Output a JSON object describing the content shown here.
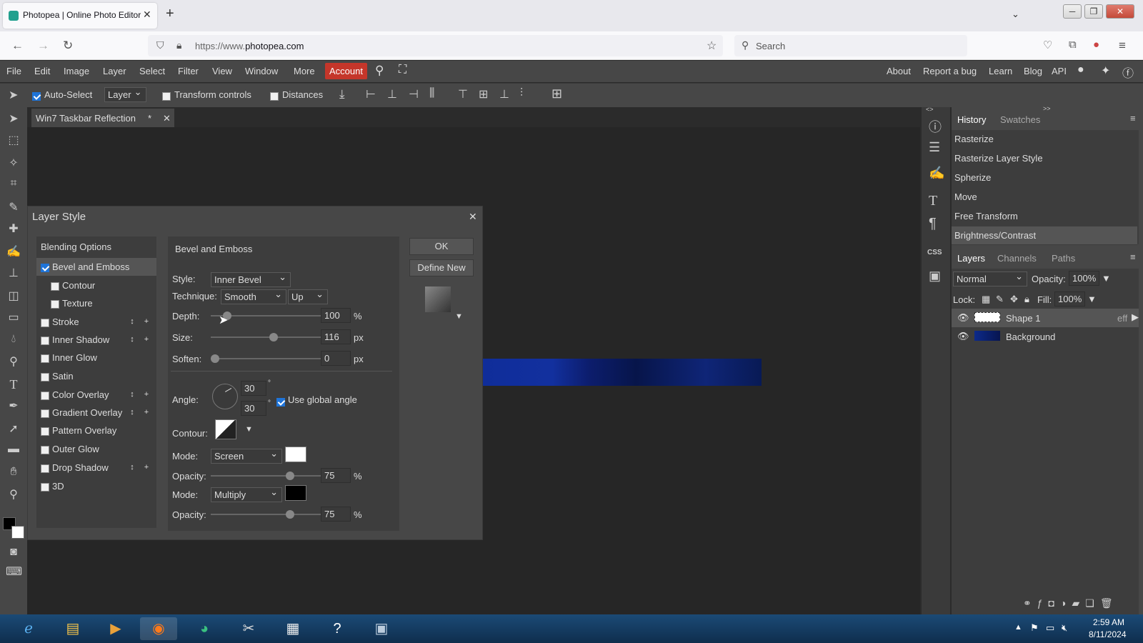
{
  "browser": {
    "tab_title": "Photopea | Online Photo Editor",
    "url_prefix": "https://www.",
    "url_domain": "photopea.com",
    "search_placeholder": "Search"
  },
  "menubar": {
    "items": [
      "File",
      "Edit",
      "Image",
      "Layer",
      "Select",
      "Filter",
      "View",
      "Window",
      "More"
    ],
    "account": "Account",
    "right_links": [
      "About",
      "Report a bug",
      "Learn",
      "Blog",
      "API"
    ]
  },
  "options": {
    "auto_select": "Auto-Select",
    "auto_select_checked": true,
    "target": "Layer",
    "transform_controls": "Transform controls",
    "distances": "Distances"
  },
  "document": {
    "tab": "Win7 Taskbar Reflection",
    "modified": "*"
  },
  "history": {
    "tabs": [
      "History",
      "Swatches"
    ],
    "items": [
      "Rasterize",
      "Rasterize Layer Style",
      "Spherize",
      "Move",
      "Free Transform",
      "Brightness/Contrast"
    ]
  },
  "layers": {
    "tabs": [
      "Layers",
      "Channels",
      "Paths"
    ],
    "blend_mode": "Normal",
    "opacity_label": "Opacity:",
    "opacity": "100%",
    "lock_label": "Lock:",
    "fill_label": "Fill:",
    "fill": "100%",
    "items": [
      {
        "name": "Shape 1",
        "fx": "eff"
      },
      {
        "name": "Background",
        "fx": ""
      }
    ]
  },
  "dialog": {
    "title": "Layer Style",
    "ok": "OK",
    "define_new": "Define New",
    "list": [
      {
        "label": "Blending Options"
      },
      {
        "label": "Bevel and Emboss",
        "checked": true
      },
      {
        "label": "Contour",
        "checked": false
      },
      {
        "label": "Texture",
        "checked": false
      },
      {
        "label": "Stroke",
        "checked": false
      },
      {
        "label": "Inner Shadow",
        "checked": false
      },
      {
        "label": "Inner Glow",
        "checked": false
      },
      {
        "label": "Satin",
        "checked": false
      },
      {
        "label": "Color Overlay",
        "checked": false
      },
      {
        "label": "Gradient Overlay",
        "checked": false
      },
      {
        "label": "Pattern Overlay",
        "checked": false
      },
      {
        "label": "Outer Glow",
        "checked": false
      },
      {
        "label": "Drop Shadow",
        "checked": false
      },
      {
        "label": "3D",
        "checked": false
      }
    ],
    "section": "Bevel and Emboss",
    "style_label": "Style:",
    "style": "Inner Bevel",
    "technique_label": "Technique:",
    "technique": "Smooth",
    "direction": "Up",
    "depth_label": "Depth:",
    "depth": "100",
    "depth_unit": "%",
    "size_label": "Size:",
    "size": "116",
    "size_unit": "px",
    "soften_label": "Soften:",
    "soften": "0",
    "soften_unit": "px",
    "angle_label": "Angle:",
    "angle": "30",
    "altitude": "30",
    "deg": "°",
    "global_angle": "Use global angle",
    "contour_label": "Contour:",
    "highlight_mode_label": "Mode:",
    "highlight_mode": "Screen",
    "highlight_opacity_label": "Opacity:",
    "highlight_opacity": "75",
    "shadow_mode_label": "Mode:",
    "shadow_mode": "Multiply",
    "shadow_opacity_label": "Opacity:",
    "shadow_opacity": "75",
    "pct": "%",
    "sliders": {
      "depth": 0.12,
      "size": 0.58,
      "soften": 0.0,
      "hi_opacity": 0.74,
      "sh_opacity": 0.74
    }
  },
  "taskbar": {
    "time": "2:59 AM",
    "date": "8/11/2024"
  },
  "colors": {
    "accent": "#1f74d8",
    "account": "#c5362a",
    "highlight": "#ffffff",
    "shadow": "#000000"
  }
}
